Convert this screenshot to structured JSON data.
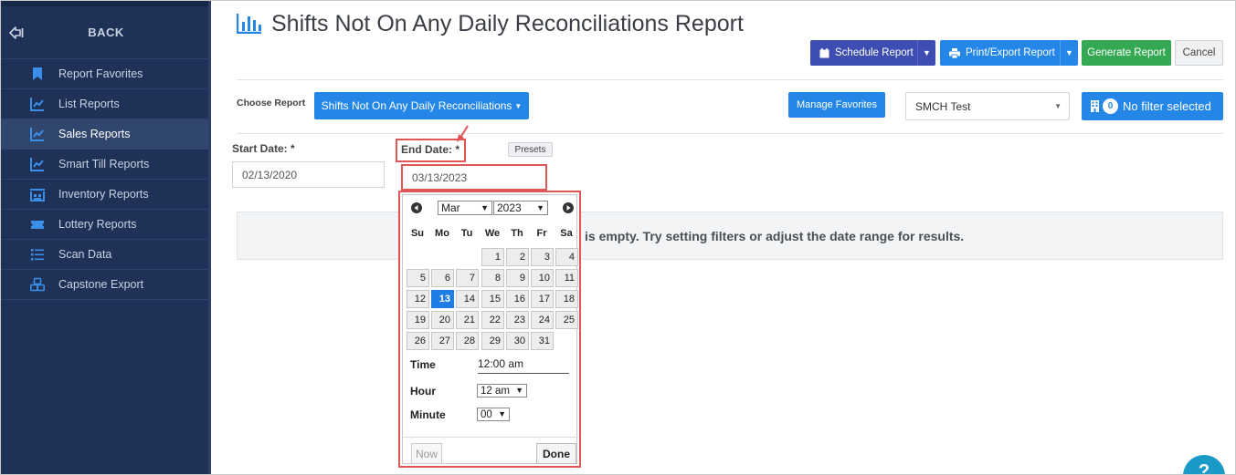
{
  "sidebar": {
    "back_label": "BACK",
    "items": [
      {
        "label": "Report Favorites",
        "icon": "bookmark-icon"
      },
      {
        "label": "List Reports",
        "icon": "line-chart-icon"
      },
      {
        "label": "Sales Reports",
        "icon": "line-chart-icon",
        "active": true
      },
      {
        "label": "Smart Till Reports",
        "icon": "line-chart-icon"
      },
      {
        "label": "Inventory Reports",
        "icon": "warehouse-icon"
      },
      {
        "label": "Lottery Reports",
        "icon": "ticket-icon"
      },
      {
        "label": "Scan Data",
        "icon": "list-icon"
      },
      {
        "label": "Capstone Export",
        "icon": "boxes-icon"
      }
    ]
  },
  "header": {
    "title": "Shifts Not On Any Daily Reconciliations Report",
    "schedule_label": "Schedule Report",
    "print_label": "Print/Export Report",
    "generate_label": "Generate Report",
    "cancel_label": "Cancel"
  },
  "filters": {
    "choose_label": "Choose Report",
    "report_selected": "Shifts Not On Any Daily Reconciliations",
    "manage_label": "Manage Favorites",
    "store_selected": "SMCH Test",
    "filter_count": "0",
    "filter_label": "No filter selected"
  },
  "dates": {
    "start_label": "Start Date: *",
    "start_value": "02/13/2020",
    "end_label": "End Date: *",
    "end_value": "03/13/2023",
    "presets_label": "Presets"
  },
  "empty_message": "is empty. Try setting filters or adjust the date range for results.",
  "picker": {
    "month": "Mar",
    "year": "2023",
    "dow": [
      "Su",
      "Mo",
      "Tu",
      "We",
      "Th",
      "Fr",
      "Sa"
    ],
    "first_weekday": 3,
    "days_in_month": 31,
    "selected_day": 13,
    "time_label": "Time",
    "time_value": "12:00 am",
    "hour_label": "Hour",
    "hour_value": "12 am",
    "minute_label": "Minute",
    "minute_value": "00",
    "now_label": "Now",
    "done_label": "Done"
  },
  "help": {
    "label": "?"
  },
  "colors": {
    "sidebar_bg": "#1f3156",
    "primary": "#2487e8",
    "schedule": "#3e4db1",
    "generate": "#34a853",
    "highlight": "#e25555"
  }
}
